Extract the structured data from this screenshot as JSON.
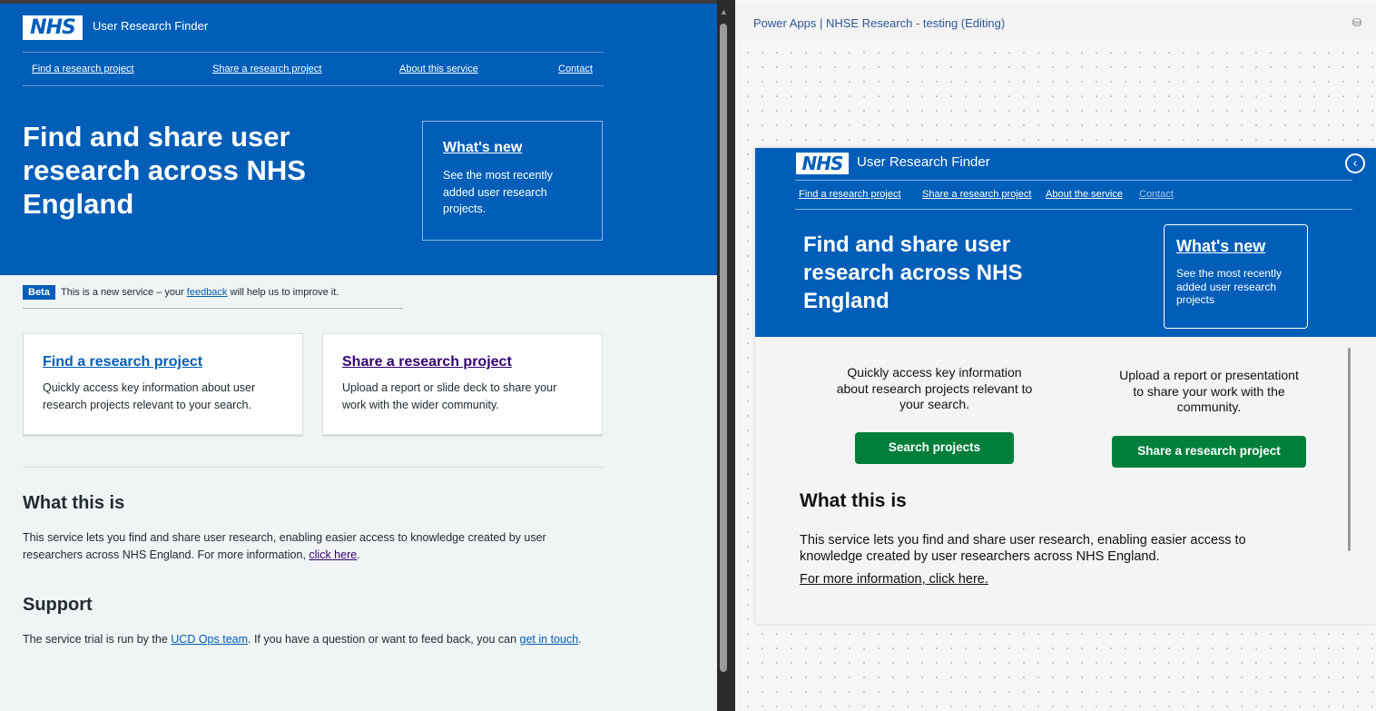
{
  "left": {
    "header": {
      "logo": "NHS",
      "service_name": "User Research Finder",
      "nav": [
        "Find a research project",
        "Share a research project",
        "About this service",
        "Contact"
      ],
      "hero_title": "Find and share user research across NHS England",
      "whats_new": {
        "title": "What's new",
        "description": "See the most recently added user research projects."
      }
    },
    "beta": {
      "tag": "Beta",
      "text_before": "This is a new service – your ",
      "link": "feedback",
      "text_after": " will help us to improve it."
    },
    "cards": [
      {
        "title": "Find a research project",
        "description": "Quickly access key information about user research projects relevant to your search."
      },
      {
        "title": "Share a research project",
        "description": "Upload a report or slide deck to share your work with the wider community."
      }
    ],
    "what_this_is": {
      "heading": "What this is",
      "text": "This service lets you find and share user research, enabling easier access to knowledge created by user researchers across NHS England. For more information, ",
      "link": "click here",
      "after": "."
    },
    "support": {
      "heading": "Support",
      "text_before": "The service trial is run by the ",
      "link1": "UCD Ops team",
      "text_middle": ". If you have a question or want to feed back, you can ",
      "link2": "get in touch",
      "after": "."
    }
  },
  "right": {
    "window_title": "Power Apps  |  NHSE Research - testing (Editing)",
    "app": {
      "logo": "NHS",
      "service_name": "User Research Finder",
      "back_icon": "chevron-left-circle-icon",
      "nav": [
        "Find a research project",
        "Share a research project",
        "About the service",
        "Contact"
      ],
      "hero_title": "Find and share user research across NHS England",
      "whats_new": {
        "title": "What's new",
        "description": "See the most recently added user research projects"
      },
      "find_blurb": "Quickly access key information about research projects relevant to your search.",
      "share_blurb": "Upload a report or presentationt to share your work with the community.",
      "search_button": "Search projects",
      "share_button": "Share  a research project",
      "heading": "What this is",
      "paragraph": "This service lets you find and share user research, enabling easier access to knowledge created by user researchers across NHS England.",
      "more_link": "For more information, click here."
    }
  },
  "colors": {
    "nhs_blue": "#005eb8",
    "nhs_green": "#007f3b",
    "visited_purple": "#330072"
  }
}
